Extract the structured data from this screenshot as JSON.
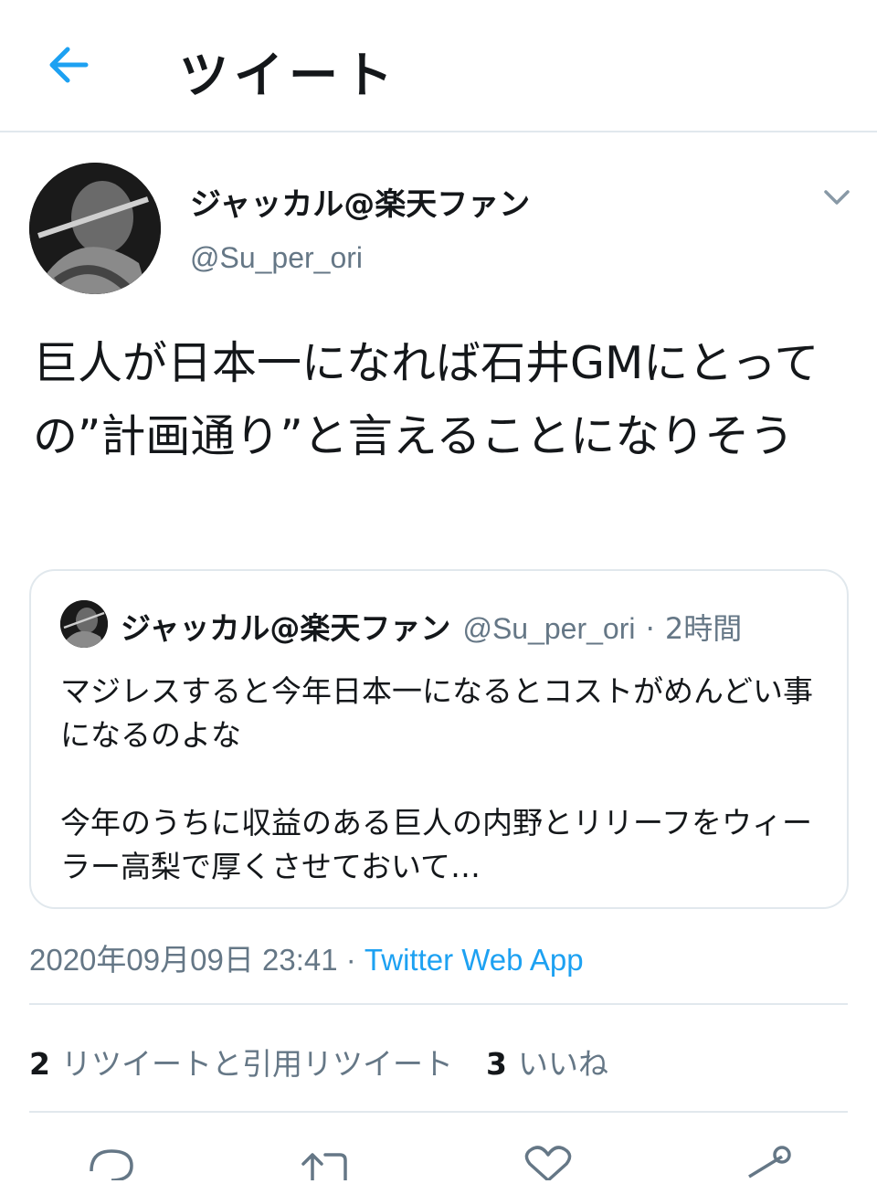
{
  "header": {
    "title": "ツイート",
    "back_icon": "arrow-left-icon"
  },
  "tweet": {
    "author_name": "ジャッカル@楽天ファン",
    "author_handle": "@Su_per_ori",
    "text": "巨人が日本一になれば石井GMにとっての”計画通り”と言えることになりそう",
    "timestamp": "2020年09月09日 23:41",
    "separator": " · ",
    "source": "Twitter Web App",
    "retweet_count": "2",
    "retweet_label": "リツイートと引用リツイート",
    "like_count": "3",
    "like_label": "いいね"
  },
  "quoted_tweet": {
    "author_name": "ジャッカル@楽天ファン",
    "author_handle": "@Su_per_ori",
    "separator": "·",
    "time": "2時間",
    "text": "マジレスすると今年日本一になるとコストがめんどい事になるのよな\n\n今年のうちに収益のある巨人の内野とリリーフをウィーラー高梨で厚くさせておいて…"
  },
  "actions": [
    "reply-icon",
    "retweet-icon",
    "like-icon",
    "share-icon"
  ],
  "colors": {
    "accent": "#1da1f2",
    "secondary_text": "#657786",
    "border": "#e1e8ed"
  }
}
